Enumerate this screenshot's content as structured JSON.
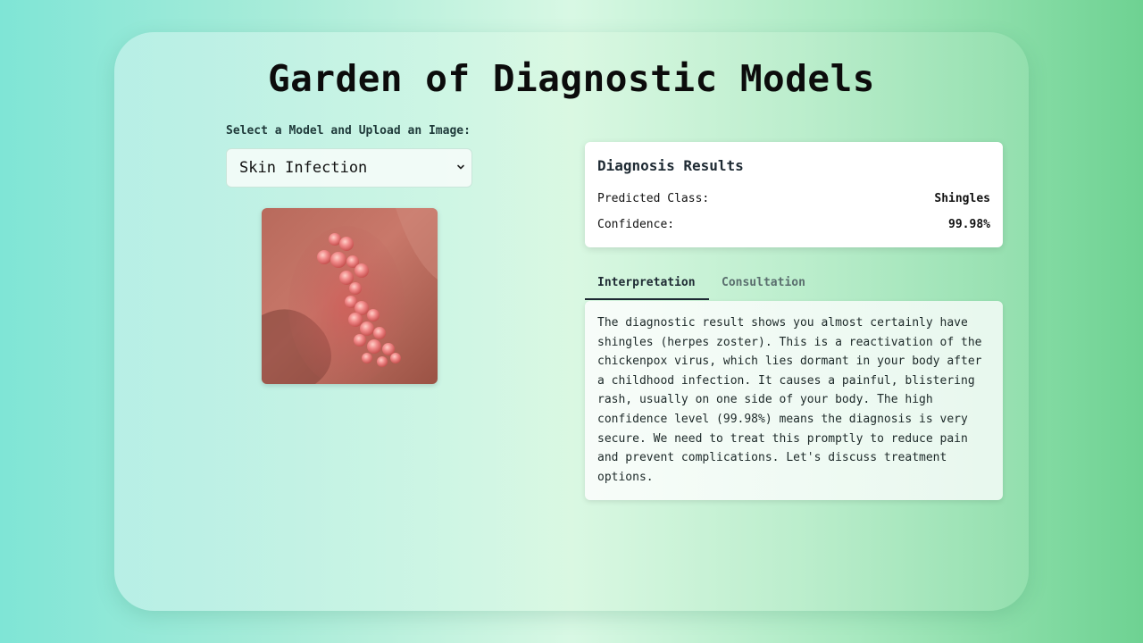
{
  "app": {
    "title": "Garden of Diagnostic Models"
  },
  "upload": {
    "label": "Select a Model and Upload an Image:",
    "selected_model": "Skin Infection",
    "preview_alt": "uploaded skin image"
  },
  "results": {
    "title": "Diagnosis Results",
    "predicted_label": "Predicted Class:",
    "predicted_value": "Shingles",
    "confidence_label": "Confidence:",
    "confidence_value": "99.98%"
  },
  "tabs": [
    {
      "label": "Interpretation",
      "active": true
    },
    {
      "label": "Consultation",
      "active": false
    }
  ],
  "interpretation": {
    "text": "The diagnostic result shows you almost certainly have shingles (herpes zoster). This is a reactivation of the chickenpox virus, which lies dormant in your body after a childhood infection. It causes a painful, blistering rash, usually on one side of your body. The high confidence level (99.98%) means the diagnosis is very secure. We need to treat this promptly to reduce pain and prevent complications. Let's discuss treatment options."
  },
  "colors": {
    "accent": "#1e2a33",
    "background_left": "#7fe5d6",
    "background_right": "#6ed292"
  },
  "icons": {
    "select_chevron": "chevron-down-icon"
  }
}
